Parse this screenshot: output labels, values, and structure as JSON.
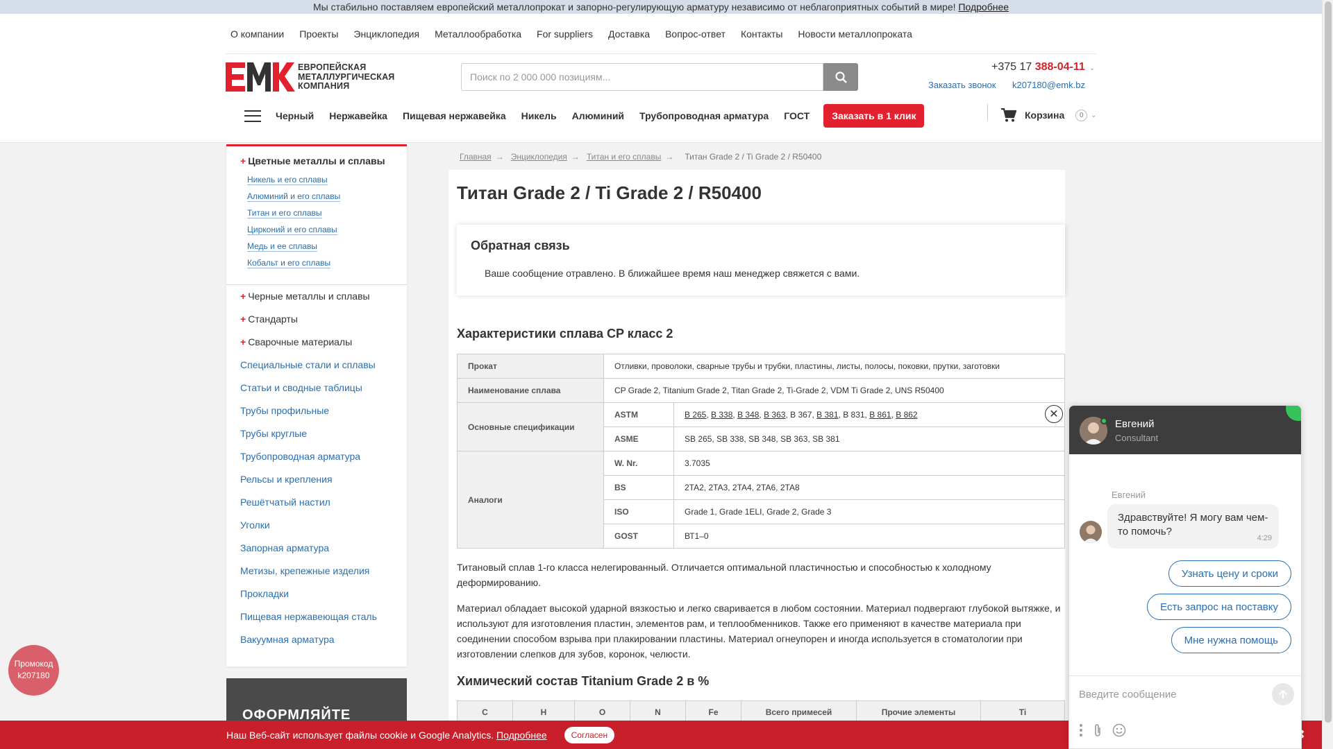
{
  "notice": {
    "text": "Мы стабильно поставляем европейский металлопрокат и запорно-регулирующую арматуру независимо от неблагоприятных событий в мире!",
    "link": "Подробнее"
  },
  "topnav": [
    "О компании",
    "Проекты",
    "Энциклопедия",
    "Металлообработка",
    "For suppliers",
    "Доставка",
    "Вопрос-ответ",
    "Контакты",
    "Новости металлопроката"
  ],
  "logo": {
    "mark": "ЕМК",
    "line1": "ЕВРОПЕЙСКАЯ",
    "line2": "МЕТАЛЛУРГИЧЕСКАЯ",
    "line3": "КОМПАНИЯ"
  },
  "search": {
    "placeholder": "Поиск по 2 000 000 позициям..."
  },
  "contact": {
    "phone_prefix": "+375 17",
    "phone_number": "388-04-11",
    "callback": "Заказать звонок",
    "email": "k207180@emk.bz"
  },
  "catnav": {
    "items": [
      "Черный",
      "Нержавейка",
      "Пищевая нержавейка",
      "Никель",
      "Алюминий",
      "Трубопроводная арматура",
      "ГОСТ"
    ],
    "order_button": "Заказать в 1 клик",
    "cart_label": "Корзина",
    "cart_count": "0"
  },
  "sidebar": {
    "group_title": "Цветные металлы и сплавы",
    "sub_items": [
      "Никель и его сплавы",
      "Алюминий и его сплавы",
      "Титан и его сплавы",
      "Цирконий и его сплавы",
      "Медь и ее сплавы",
      "Кобальт и его сплавы"
    ],
    "expandable": [
      "Черные металлы и сплавы",
      "Стандарты",
      "Сварочные материалы"
    ],
    "links": [
      "Специальные стали и сплавы",
      "Статьи и сводные таблицы",
      "Трубы профильные",
      "Трубы круглые",
      "Трубопроводная арматура",
      "Рельсы и крепления",
      "Решётчатый настил",
      "Уголки",
      "Запорная арматура",
      "Метизы, крепежные изделия",
      "Прокладки",
      "Пищевая нержавеющая сталь",
      "Вакуумная арматура"
    ],
    "promo_box_text": "ОФОРМЛЯЙТЕ"
  },
  "breadcrumb": {
    "items": [
      "Главная",
      "Энциклопедия",
      "Титан и его сплавы"
    ],
    "current": "Титан Grade 2 / Ti Grade 2 / R50400"
  },
  "page_title": "Титан Grade 2 / Ti Grade 2 / R50400",
  "feedback": {
    "title": "Обратная связь",
    "message": "Ваше сообщение отравлено. В ближайшее время наш менеджер свяжется с вами."
  },
  "specs": {
    "title": "Характеристики сплава CP класс 2",
    "prokat_label": "Прокат",
    "prokat_value": "Отливки, проволоки, сварные трубы и трубки, пластины, листы, полосы, поковки, прутки, заготовки",
    "name_label": "Наименование сплава",
    "name_value": "CP Grade 2, Titanium Grade 2, Titan Grade 2, Ti-Grade 2, VDM Ti Grade 2, UNS R50400",
    "main_spec_label": "Основные спецификации",
    "astm_label": "ASTM",
    "astm_values": [
      "B 265",
      "B 338",
      "B 348",
      "B 363",
      "B 367",
      "B 381",
      "B 831",
      "B 861",
      "B 862"
    ],
    "asme_label": "ASME",
    "asme_value": "SB 265, SB 338, SB 348, SB 363, SB 381",
    "analogs_label": "Аналоги",
    "wnr_label": "W. Nr.",
    "wnr_value": "3.7035",
    "bs_label": "BS",
    "bs_value": "2TA2, 2TA3, 2TA4, 2TA6, 2TA8",
    "iso_label": "ISO",
    "iso_value": "Grade 1, Grade 1ELI, Grade 2, Grade 3",
    "gost_label": "GOST",
    "gost_value": "ВТ1–0"
  },
  "description": {
    "p1": "Титановый сплав 1-го класса нелегированный. Отличается оптимальной пластичностью и способностью к холодному деформированию.",
    "p2": "Материал обладает высокой ударной вязкостью и легко сваривается в любом состоянии. Материал подвергают глубокой вытяжке, и используют для изготовления пластин, элементов рам, и теплообменников. Также его применяют в качестве материала при соединении способом взрыва при плакировании пластины. Материал огнеупорен и иногда используется в стоматологии при изготовлении слепков для зубов, коронок, челюсти."
  },
  "chem": {
    "title": "Химический состав Titanium Grade 2 в %",
    "headers": [
      "C",
      "H",
      "O",
      "N",
      "Fe",
      "Всего примесей",
      "Прочие элементы",
      "Ti"
    ]
  },
  "promo_circle": {
    "line1": "Промокод",
    "line2": "k207180"
  },
  "cookie": {
    "text": "Наш Веб-сайт использует файлы cookie и Google Analytics.",
    "link": "Подробнее",
    "button": "Согласен"
  },
  "chat": {
    "agent_name": "Евгений",
    "agent_role": "Consultant",
    "author": "Евгений",
    "greeting": "Здравствуйте! Я могу вам чем-то помочь?",
    "time": "4:29",
    "options": [
      "Узнать цену и сроки",
      "Есть запрос на поставку",
      "Мне нужна помощь"
    ],
    "input_placeholder": "Введите сообщение"
  },
  "colors": {
    "brand_red": "#e3212e",
    "link_blue": "#2a6fb0",
    "chat_dark": "#3d3d3d",
    "online_green": "#36c35c"
  }
}
